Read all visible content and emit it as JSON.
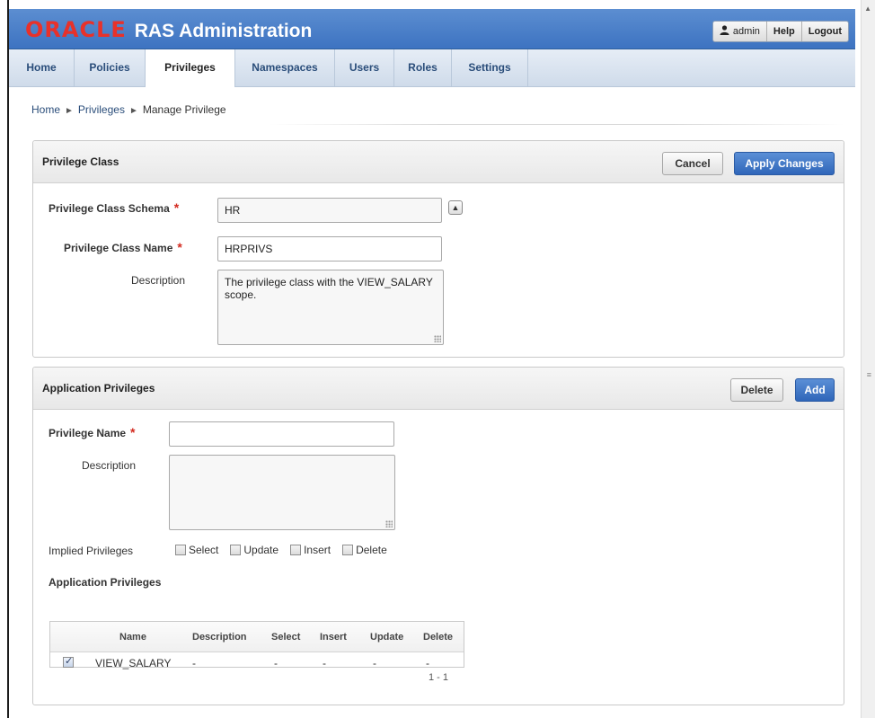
{
  "header": {
    "logo": "ORACLE",
    "title": "RAS Administration",
    "user": "admin",
    "help": "Help",
    "logout": "Logout"
  },
  "tabs": [
    {
      "label": "Home"
    },
    {
      "label": "Policies"
    },
    {
      "label": "Privileges",
      "active": true
    },
    {
      "label": "Namespaces"
    },
    {
      "label": "Users"
    },
    {
      "label": "Roles"
    },
    {
      "label": "Settings"
    }
  ],
  "breadcrumb": [
    "Home",
    "Privileges",
    "Manage Privilege"
  ],
  "privilege_class": {
    "title": "Privilege Class",
    "cancel": "Cancel",
    "apply": "Apply Changes",
    "schema_label": "Privilege Class Schema",
    "schema_value": "HR",
    "name_label": "Privilege Class Name",
    "name_value": "HRPRIVS",
    "desc_label": "Description",
    "desc_value": "The privilege class with the VIEW_SALARY scope."
  },
  "app_privileges": {
    "title": "Application Privileges",
    "delete": "Delete",
    "add": "Add",
    "name_label": "Privilege Name",
    "name_value": "",
    "desc_label": "Description",
    "desc_value": "",
    "implied_label": "Implied Privileges",
    "implied": [
      "Select",
      "Update",
      "Insert",
      "Delete"
    ],
    "table_title": "Application Privileges",
    "columns": [
      "Name",
      "Description",
      "Select",
      "Insert",
      "Update",
      "Delete"
    ],
    "rows": [
      {
        "checked": true,
        "name": "VIEW_SALARY",
        "description": "-",
        "select": "-",
        "insert": "-",
        "update": "-",
        "delete": "-"
      }
    ],
    "pagination": "1 - 1"
  },
  "colors": {
    "header_blue": "#3d73c1",
    "oracle_red": "#e8312a",
    "primary_button": "#2f66b9",
    "required": "#d32a1f"
  },
  "icons": [
    "user-icon",
    "chevron-up-icon",
    "resize-grip-icon"
  ]
}
